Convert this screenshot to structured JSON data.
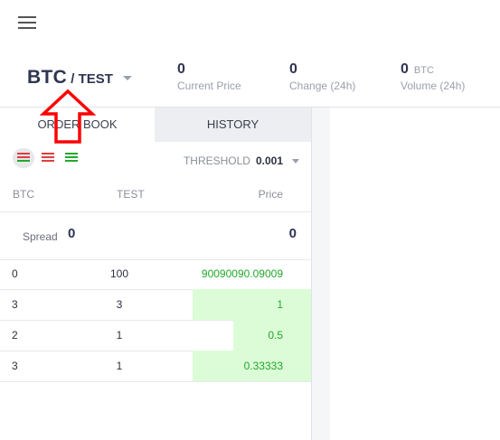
{
  "market": {
    "base": "BTC",
    "quote_sep": " / TEST"
  },
  "stats": [
    {
      "value": "0",
      "unit": "",
      "label": "Current Price"
    },
    {
      "value": "0",
      "unit": "",
      "label": "Change (24h)"
    },
    {
      "value": "0",
      "unit": "BTC",
      "label": "Volume (24h)"
    }
  ],
  "tabs": {
    "order_book": "ORDER BOOK",
    "history": "HISTORY"
  },
  "toolbar": {
    "threshold_label": "THRESHOLD",
    "threshold_value": "0.001"
  },
  "columns": {
    "c1": "BTC",
    "c2": "TEST",
    "c3": "Price"
  },
  "spread": {
    "label": "Spread",
    "value": "0",
    "price": "0"
  },
  "rows": [
    {
      "btc": "0",
      "test": "100",
      "price": "90090090.09009",
      "depth": 0
    },
    {
      "btc": "3",
      "test": "3",
      "price": "1",
      "depth": 0.38
    },
    {
      "btc": "2",
      "test": "1",
      "price": "0.5",
      "depth": 0.25
    },
    {
      "btc": "3",
      "test": "1",
      "price": "0.33333",
      "depth": 0.38
    }
  ],
  "colors": {
    "accent_dark": "#2e3550",
    "buy_green": "#22a82a",
    "depth_green": "#dcfcd7",
    "sell_red": "#e03e3e",
    "annotation_red": "#ff0000"
  },
  "icons": [
    "menu-icon",
    "caret-down-icon",
    "orderbook-all-icon",
    "orderbook-sell-icon",
    "orderbook-buy-icon"
  ]
}
